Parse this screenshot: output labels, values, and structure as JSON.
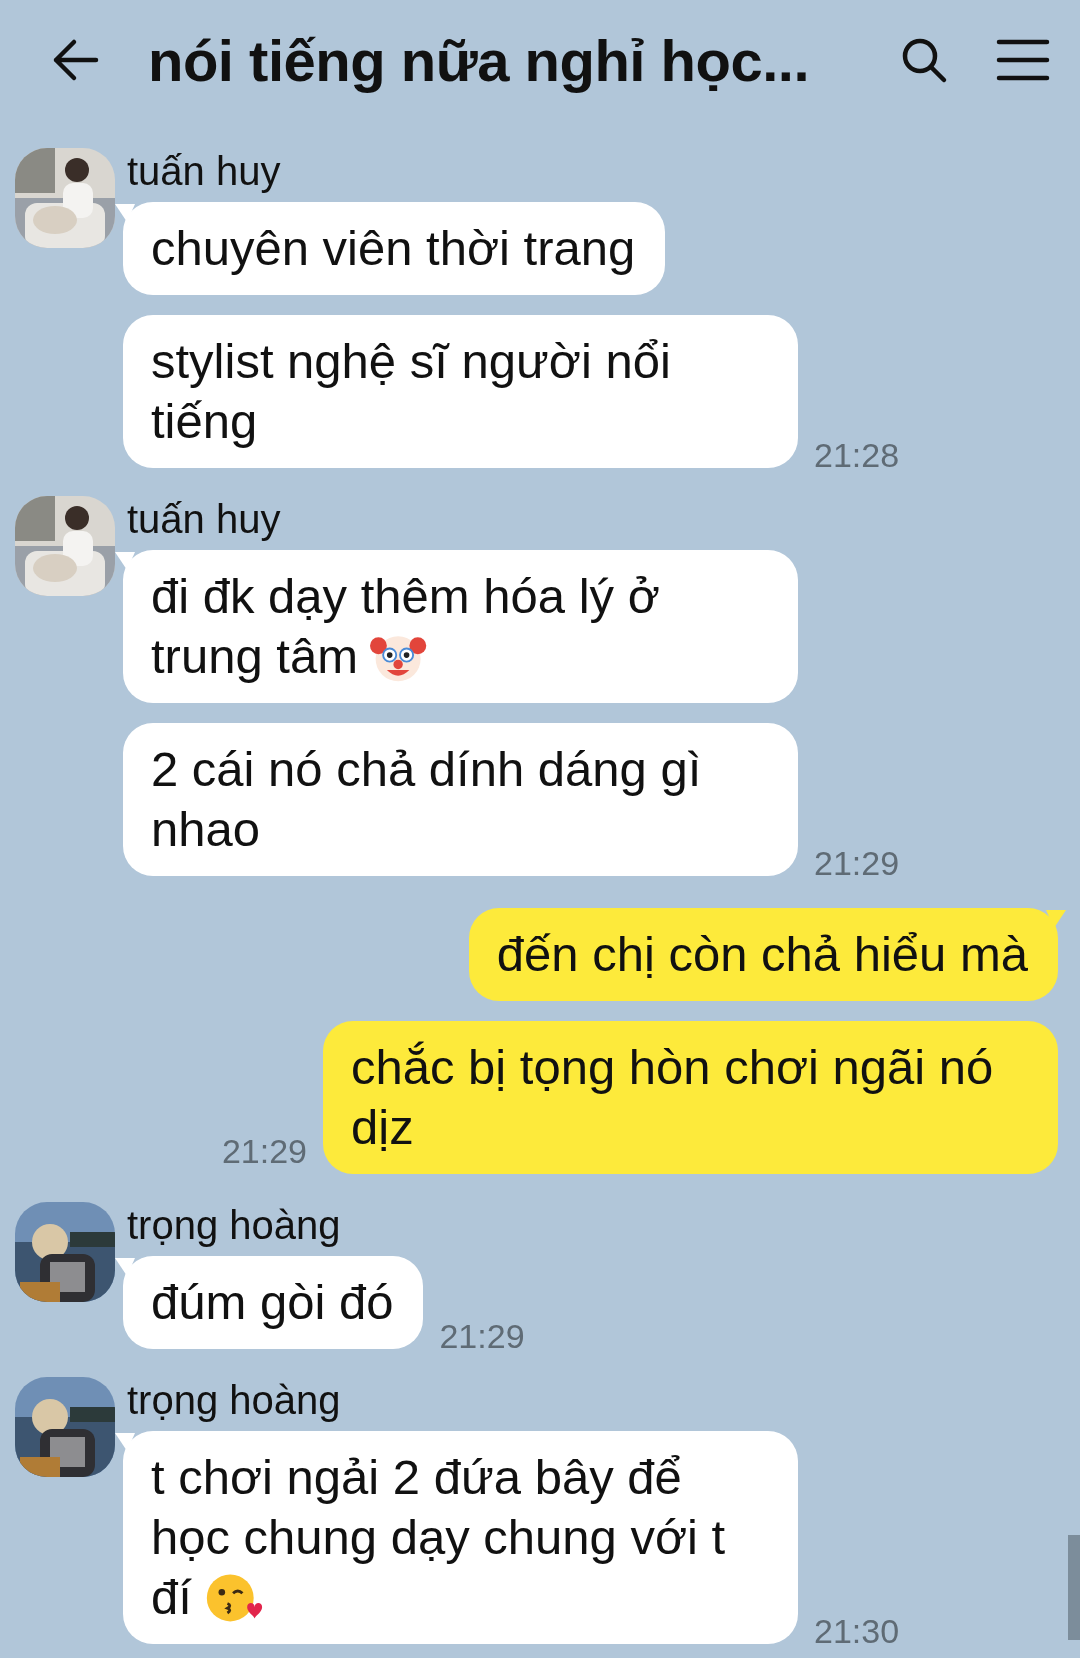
{
  "header": {
    "title": "nói tiếng nữa nghỉ học..."
  },
  "groups": [
    {
      "kind": "incoming",
      "sender": "tuấn huy",
      "avatar": {
        "kind": "picture"
      },
      "bubbles": [
        {
          "kind": "plain",
          "lines": [
            "chuyên viên thời trang"
          ]
        },
        {
          "kind": "plain",
          "lines": [
            "stylist nghệ sĩ người nổi",
            "tiếng"
          ],
          "time": "21:28"
        }
      ]
    },
    {
      "kind": "incoming",
      "sender": "tuấn huy",
      "avatar": {
        "kind": "picture"
      },
      "bubbles": [
        {
          "kind": "clown",
          "lines": [
            "đi đk dạy thêm hóa lý ở",
            "trung tâm"
          ]
        },
        {
          "kind": "plain",
          "lines": [
            "2 cái nó chả dính dáng gì",
            "nhao"
          ],
          "time": "21:29"
        }
      ]
    },
    {
      "kind": "outgoing",
      "bubbles": [
        {
          "kind": "plain",
          "lines": [
            "đến chị còn chả hiểu mà"
          ]
        },
        {
          "kind": "plain",
          "lines": [
            "chắc bị tọng hòn chơi ngãi nó",
            "dịz"
          ],
          "time": "21:29"
        }
      ]
    },
    {
      "kind": "incoming",
      "sender": "trọng hoàng",
      "avatar": {
        "kind": "picture"
      },
      "bubbles": [
        {
          "kind": "plain",
          "lines": [
            "đúm gòi đó"
          ],
          "time": "21:29"
        }
      ]
    },
    {
      "kind": "incoming",
      "sender": "trọng hoàng",
      "avatar": {
        "kind": "picture"
      },
      "bubbles": [
        {
          "kind": "kiss",
          "lines": [
            "t chơi ngải 2 đứa bây để",
            "học chung dạy chung với t",
            "đí"
          ],
          "time": "21:30"
        }
      ]
    }
  ]
}
